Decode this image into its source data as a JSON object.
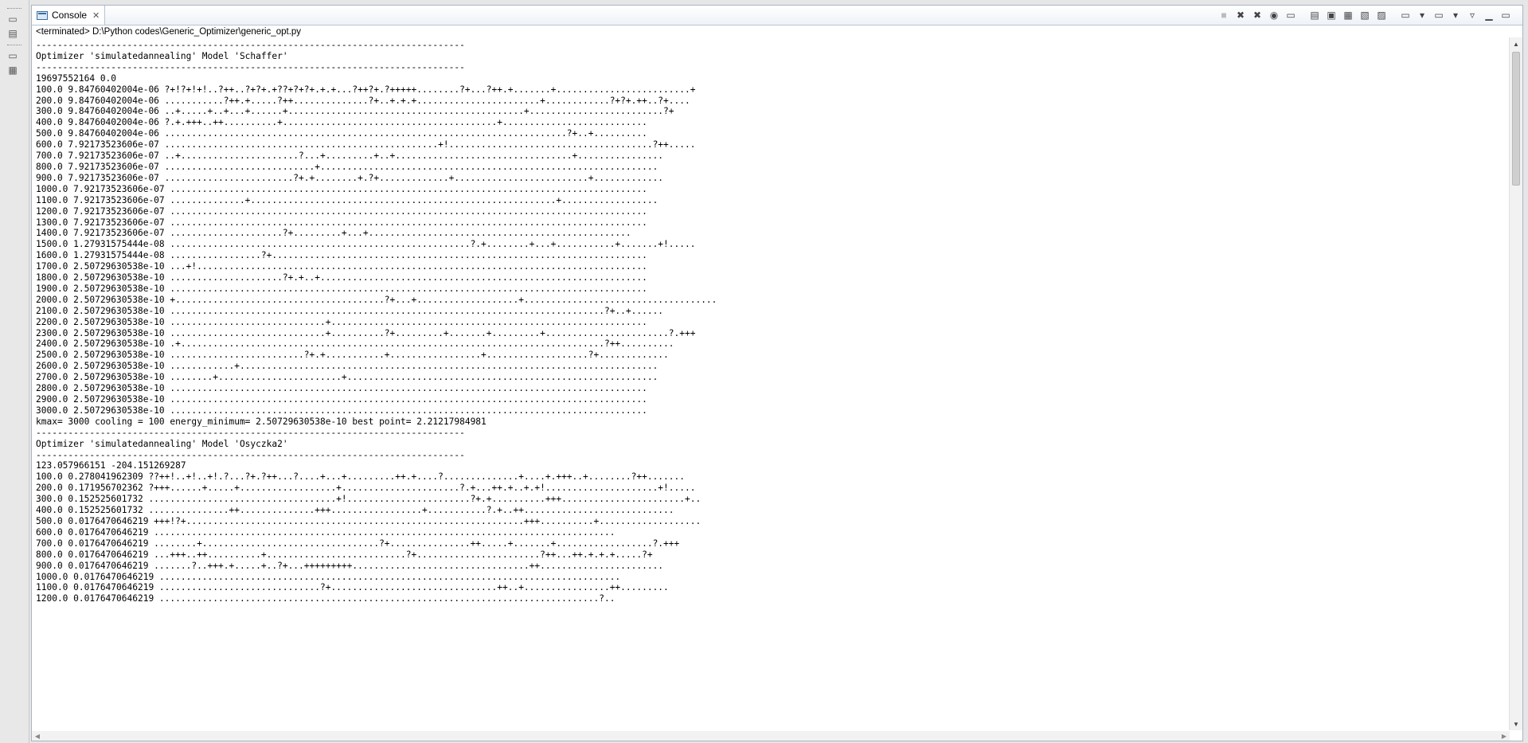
{
  "tab": {
    "label": "Console"
  },
  "status": "<terminated> D:\\Python codes\\Generic_Optimizer\\generic_opt.py",
  "toolbar_icons": [
    "terminate-icon",
    "remove-launch-icon",
    "remove-all-terminated-icon",
    "show-on-output-icon",
    "pin-console-icon",
    "clear-console-icon",
    "scroll-lock-icon",
    "word-wrap-icon",
    "show-console-stdout-icon",
    "show-console-stderr-icon",
    "display-selected-console-icon",
    "open-console-icon",
    "view-menu-icon",
    "minimize-icon",
    "maximize-icon"
  ],
  "console_lines": [
    "--------------------------------------------------------------------------------",
    "Optimizer 'simulatedannealing' Model 'Schaffer'",
    "--------------------------------------------------------------------------------",
    "19697552164 0.0",
    "100.0 9.84760402004e-06 ?+!?+!+!..?++..?+?+.+??+?+?+.+.+...?++?+.?+++++........?+...?++.+.......+.........................+",
    "200.0 9.84760402004e-06 ...........?++.+.....?++..............?+..+.+.+.......................+............?+?+.++..?+....",
    "300.0 9.84760402004e-06 ..+.....+..+...+......+............................................+.........................?+",
    "400.0 9.84760402004e-06 ?.+.+++..++..........+........................................+...........................",
    "500.0 9.84760402004e-06 ...........................................................................?+..+..........",
    "600.0 7.92173523606e-07 ...................................................+!......................................?++.....",
    "700.0 7.92173523606e-07 ..+......................?...+.........+..+.................................+................",
    "800.0 7.92173523606e-07 ............................+...............................................................",
    "900.0 7.92173523606e-07 ........................?+.+........+.?+.............+.........................+.............",
    "1000.0 7.92173523606e-07 .........................................................................................",
    "1100.0 7.92173523606e-07 ..............+.........................................................+..................",
    "1200.0 7.92173523606e-07 .........................................................................................",
    "1300.0 7.92173523606e-07 .........................................................................................",
    "1400.0 7.92173523606e-07 .....................?+.........+...+.................................................",
    "1500.0 1.27931575444e-08 ........................................................?.+........+...+...........+.......+!.....",
    "1600.0 1.27931575444e-08 .................?+......................................................................",
    "1700.0 2.50729630538e-10 ...+!....................................................................................",
    "1800.0 2.50729630538e-10 .....................?+.+..+.............................................................",
    "1900.0 2.50729630538e-10 .........................................................................................",
    "2000.0 2.50729630538e-10 +.......................................?+...+...................+....................................",
    "2100.0 2.50729630538e-10 .................................................................................?+..+......",
    "2200.0 2.50729630538e-10 .............................+...........................................................",
    "2300.0 2.50729630538e-10 .............................+..........?+.........+.......+.........+.......................?.+++",
    "2400.0 2.50729630538e-10 .+...............................................................................?++..........",
    "2500.0 2.50729630538e-10 .........................?+.+...........+.................+...................?+.............",
    "2600.0 2.50729630538e-10 ............+..............................................................................",
    "2700.0 2.50729630538e-10 ........+.......................+..........................................................",
    "2800.0 2.50729630538e-10 .........................................................................................",
    "2900.0 2.50729630538e-10 .........................................................................................",
    "3000.0 2.50729630538e-10 .........................................................................................",
    "kmax= 3000 cooling = 100 energy_minimum= 2.50729630538e-10 best point= 2.21217984981",
    "--------------------------------------------------------------------------------",
    "Optimizer 'simulatedannealing' Model 'Osyczka2'",
    "--------------------------------------------------------------------------------",
    "123.057966151 -204.151269287",
    "100.0 0.278041962309 ??++!..+!..+!.?...?+.?++...?....+...+.........++.+....?..............+....+.+++..+........?++.......",
    "200.0 0.171956702362 ?+++......+.....+..................+......................?.+...++.+..+.+!.....................+!.....",
    "300.0 0.152525601732 ...................................+!.......................?+.+..........+++.......................+..",
    "400.0 0.152525601732 ...............++..............+++.................+...........?.+..++............................",
    "500.0 0.0176470646219 +++!?+...............................................................+++..........+...................",
    "600.0 0.0176470646219 ......................................................................................",
    "700.0 0.0176470646219 ........+.................................?+...............++.....+.......+..................?.+++",
    "800.0 0.0176470646219 ...+++..++..........+..........................?+.......................?++...++.+.+.+.....?+",
    "900.0 0.0176470646219 .......?..+++.+.....+..?+...+++++++++.................................++.......................",
    "1000.0 0.0176470646219 ......................................................................................",
    "1100.0 0.0176470646219 ..............................?+...............................++..+................++.........",
    "1200.0 0.0176470646219 ..................................................................................?.."
  ]
}
